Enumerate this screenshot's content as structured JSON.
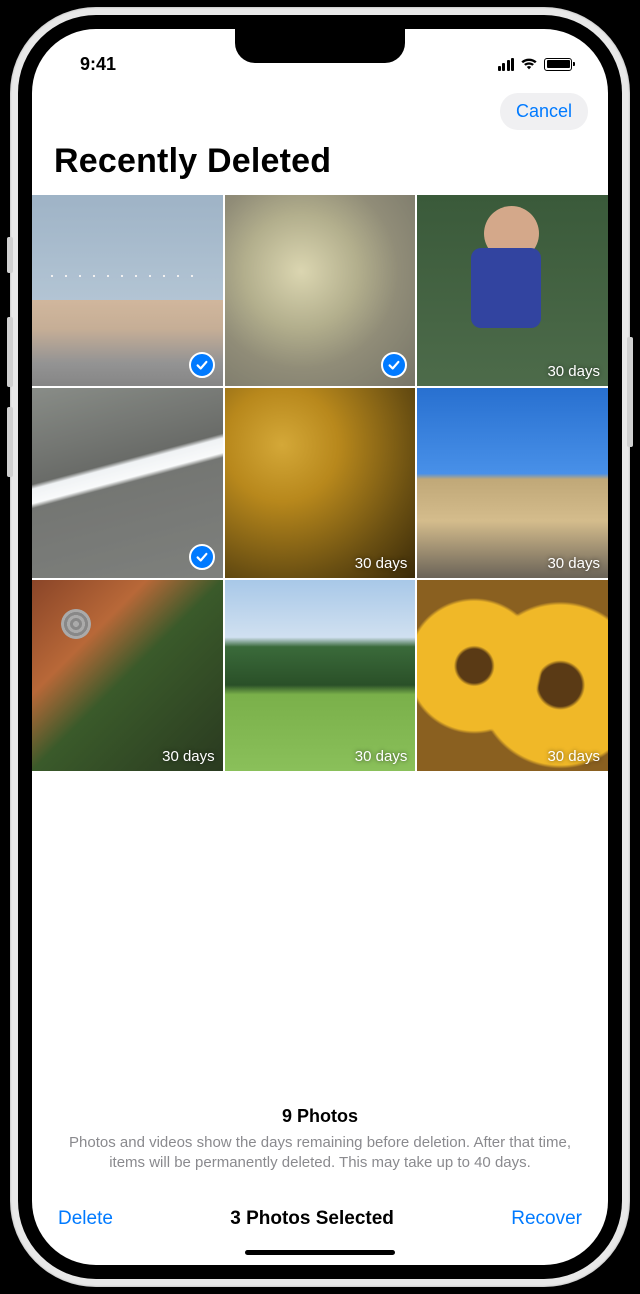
{
  "status_bar": {
    "time": "9:41"
  },
  "nav": {
    "cancel": "Cancel"
  },
  "title": "Recently Deleted",
  "photos": [
    {
      "selected": true,
      "days_label": ""
    },
    {
      "selected": true,
      "days_label": ""
    },
    {
      "selected": false,
      "days_label": "30 days"
    },
    {
      "selected": true,
      "days_label": ""
    },
    {
      "selected": false,
      "days_label": "30 days"
    },
    {
      "selected": false,
      "days_label": "30 days"
    },
    {
      "selected": false,
      "days_label": "30 days"
    },
    {
      "selected": false,
      "days_label": "30 days"
    },
    {
      "selected": false,
      "days_label": "30 days"
    }
  ],
  "summary": {
    "count_label": "9 Photos",
    "description": "Photos and videos show the days remaining before deletion. After that time, items will be permanently deleted. This may take up to 40 days."
  },
  "toolbar": {
    "delete": "Delete",
    "selection_label": "3 Photos Selected",
    "recover": "Recover"
  }
}
